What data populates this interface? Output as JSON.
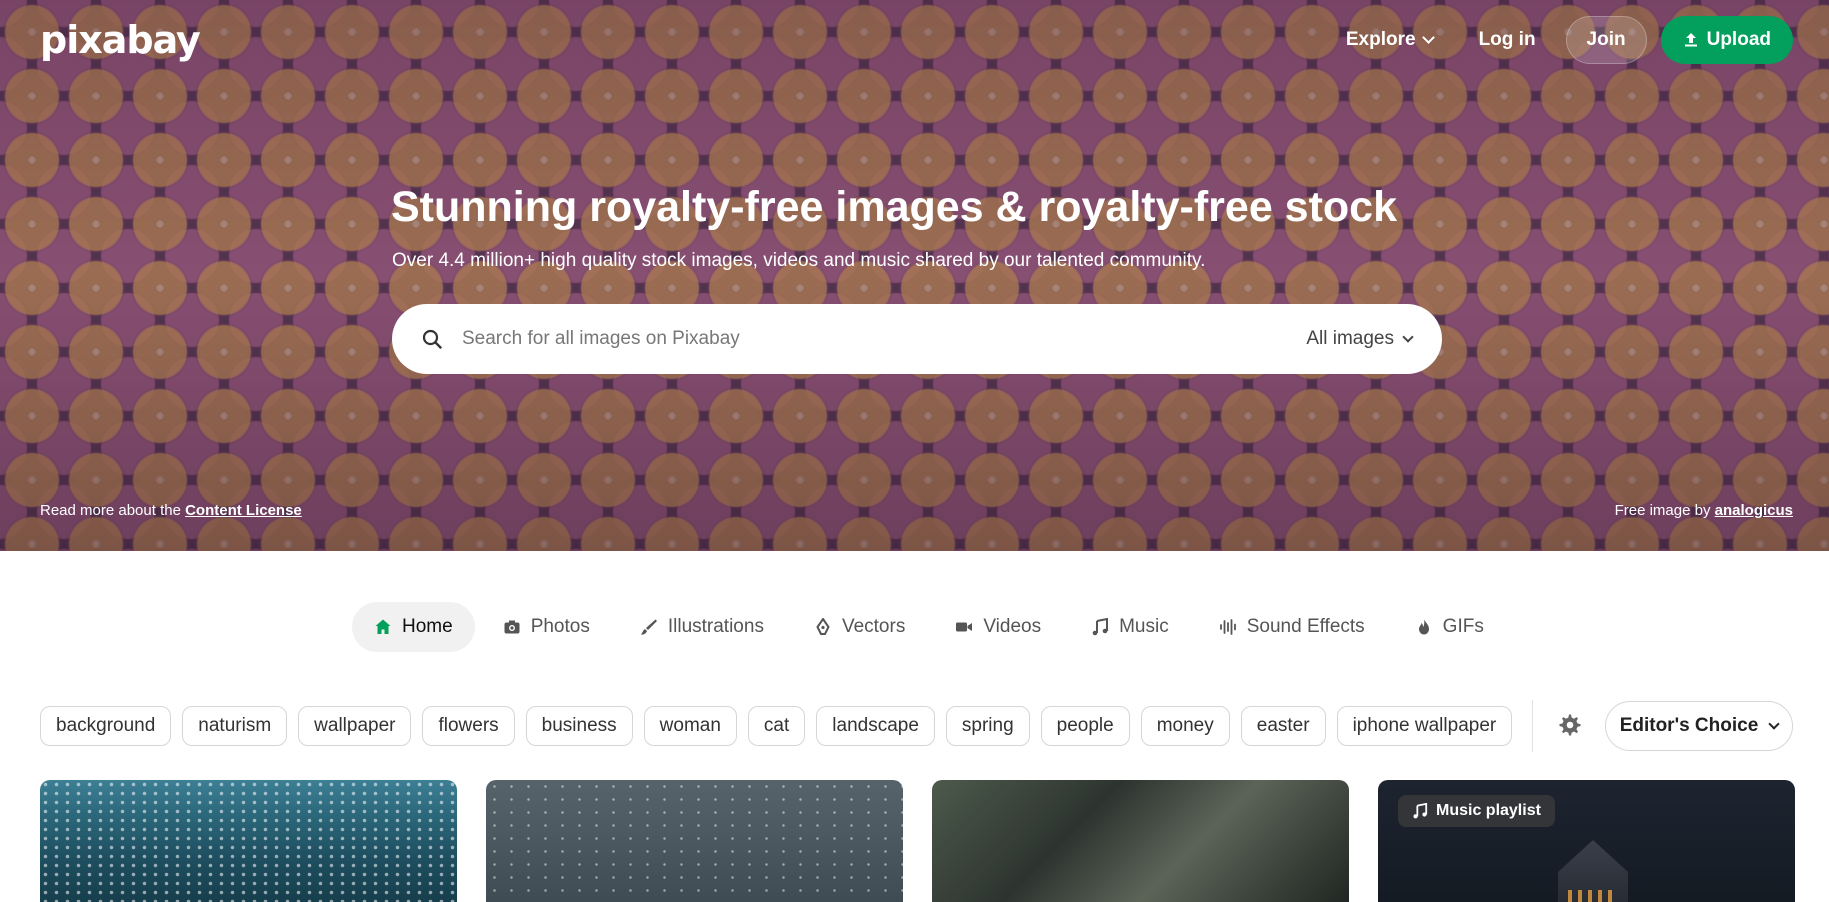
{
  "brand": {
    "logo_text": "pixabay",
    "accent_color": "#02a05c"
  },
  "topnav": {
    "explore_label": "Explore",
    "login_label": "Log in",
    "join_label": "Join",
    "upload_label": "Upload"
  },
  "hero": {
    "headline": "Stunning royalty-free images & royalty-free stock",
    "subline": "Over 4.4 million+ high quality stock images, videos and music shared by our talented community.",
    "license_prefix": "Read more about the ",
    "license_link": "Content License",
    "credit_prefix": "Free image by ",
    "credit_author": "analogicus"
  },
  "search": {
    "placeholder": "Search for all images on Pixabay",
    "value": "",
    "type_selected": "All images"
  },
  "tabs": [
    {
      "label": "Home",
      "icon": "home-icon",
      "active": true
    },
    {
      "label": "Photos",
      "icon": "camera-icon",
      "active": false
    },
    {
      "label": "Illustrations",
      "icon": "brush-icon",
      "active": false
    },
    {
      "label": "Vectors",
      "icon": "pen-nib-icon",
      "active": false
    },
    {
      "label": "Videos",
      "icon": "video-camera-icon",
      "active": false
    },
    {
      "label": "Music",
      "icon": "music-note-icon",
      "active": false
    },
    {
      "label": "Sound Effects",
      "icon": "waveform-icon",
      "active": false
    },
    {
      "label": "GIFs",
      "icon": "flame-icon",
      "active": false
    }
  ],
  "tags": [
    "background",
    "naturism",
    "wallpaper",
    "flowers",
    "business",
    "woman",
    "cat",
    "landscape",
    "spring",
    "people",
    "money",
    "easter",
    "iphone wallpaper"
  ],
  "filter": {
    "settings_icon": "gear-icon",
    "sort_selected": "Editor's Choice"
  },
  "grid": {
    "playlist_badge": "Music playlist"
  }
}
